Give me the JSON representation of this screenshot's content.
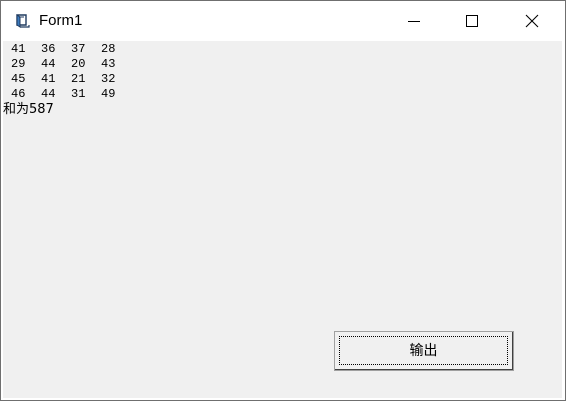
{
  "window": {
    "title": "Form1",
    "icon": "vb-form-icon",
    "controls": [
      "minimize-icon",
      "maximize-icon",
      "close-icon"
    ]
  },
  "matrix": {
    "rows": [
      [
        "41",
        "36",
        "37",
        "28"
      ],
      [
        "29",
        "44",
        "20",
        "43"
      ],
      [
        "45",
        "41",
        "21",
        "32"
      ],
      [
        "46",
        "44",
        "31",
        "49"
      ]
    ]
  },
  "sum_text": "和为587",
  "output_button": {
    "label": "输出"
  }
}
